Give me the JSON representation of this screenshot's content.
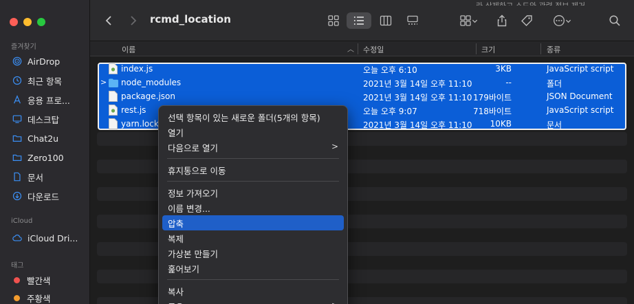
{
  "window": {
    "title": "rcmd_location",
    "topright_fragment": "라 삭제하고 소드와 관련 정보 제거"
  },
  "sidebar": {
    "favorites_label": "즐겨찾기",
    "favorites": [
      {
        "label": "AirDrop",
        "icon": "airdrop-icon"
      },
      {
        "label": "최근 항목",
        "icon": "clock-icon"
      },
      {
        "label": "응용 프로...",
        "icon": "applications-icon"
      },
      {
        "label": "데스크탑",
        "icon": "desktop-icon"
      },
      {
        "label": "Chat2u",
        "icon": "folder-icon"
      },
      {
        "label": "Zero100",
        "icon": "folder-icon"
      },
      {
        "label": "문서",
        "icon": "document-icon"
      },
      {
        "label": "다운로드",
        "icon": "download-icon"
      }
    ],
    "icloud_label": "iCloud",
    "icloud": [
      {
        "label": "iCloud Dri...",
        "icon": "cloud-icon"
      }
    ],
    "tags_label": "태그",
    "tags": [
      {
        "label": "빨간색",
        "color": "#f0524f"
      },
      {
        "label": "주황색",
        "color": "#f49c2e"
      }
    ]
  },
  "columns": {
    "name": "이름",
    "date": "수정일",
    "size": "크기",
    "kind": "종류"
  },
  "files": [
    {
      "name": "index.js",
      "date": "오늘 오후 6:10",
      "size": "3KB",
      "kind": "JavaScript script",
      "type": "js"
    },
    {
      "name": "node_modules",
      "date": "2021년 3월 14일 오후 11:10",
      "size": "--",
      "kind": "폴더",
      "type": "folder"
    },
    {
      "name": "package.json",
      "date": "2021년 3월 14일 오후 11:10",
      "size": "179바이트",
      "kind": "JSON Document",
      "type": "doc"
    },
    {
      "name": "rest.js",
      "date": "오늘 오후 9:07",
      "size": "718바이트",
      "kind": "JavaScript script",
      "type": "js"
    },
    {
      "name": "yarn.lock",
      "date": "2021년 3월 14일 오후 11:10",
      "size": "10KB",
      "kind": "문서",
      "type": "doc"
    }
  ],
  "context_menu": {
    "items": [
      {
        "label": "선택 항목이 있는 새로운 폴더(5개의 항목)"
      },
      {
        "label": "열기"
      },
      {
        "label": "다음으로 열기",
        "submenu": true
      },
      {
        "separator": true
      },
      {
        "label": "휴지통으로 이동"
      },
      {
        "separator": true
      },
      {
        "label": "정보 가져오기"
      },
      {
        "label": "이름 변경..."
      },
      {
        "label": "압축",
        "highlighted": true
      },
      {
        "label": "복제"
      },
      {
        "label": "가상본 만들기"
      },
      {
        "label": "훑어보기"
      },
      {
        "separator": true
      },
      {
        "label": "복사"
      },
      {
        "label": "공유",
        "submenu": true
      }
    ]
  },
  "colors": {
    "selection": "#0b5ed7",
    "menu_highlight": "#1f5fc8",
    "accent_icon": "#3b8ff5"
  }
}
